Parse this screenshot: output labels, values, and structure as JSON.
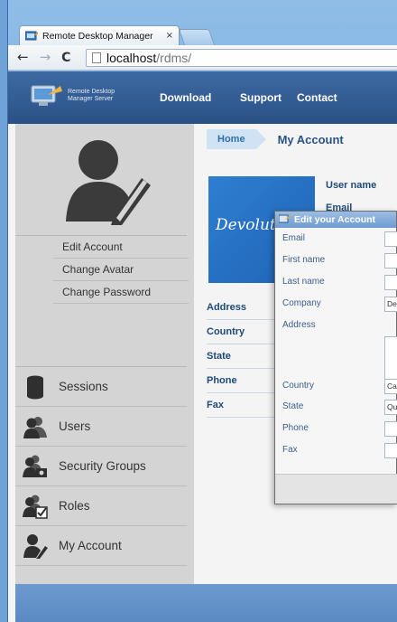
{
  "browser": {
    "tab_title": "Remote Desktop Manager",
    "tab_close": "×",
    "url_host": "localhost",
    "url_path": "/rdms/",
    "back_glyph": "←",
    "forward_glyph": "→",
    "reload_glyph": "C"
  },
  "header": {
    "logo_line1": "Remote Desktop",
    "logo_line2": "Manager Server",
    "menu": [
      "Download",
      "Support",
      "Contact"
    ]
  },
  "sidebar": {
    "account_links": [
      "Edit Account",
      "Change Avatar",
      "Change Password"
    ],
    "nav_items": [
      {
        "label": "Sessions",
        "icon": "database-icon"
      },
      {
        "label": "Users",
        "icon": "users-icon"
      },
      {
        "label": "Security Groups",
        "icon": "security-groups-icon"
      },
      {
        "label": "Roles",
        "icon": "roles-icon"
      },
      {
        "label": "My Account",
        "icon": "user-edit-icon"
      }
    ]
  },
  "content": {
    "breadcrumb_home": "Home",
    "page_title": "My Account",
    "company_logo_text": "Devolutions",
    "user_name_label": "User name",
    "email_label": "Email",
    "field_labels": [
      "Address",
      "Country",
      "State",
      "Phone",
      "Fax"
    ]
  },
  "dialog": {
    "title": "Edit your Account",
    "fields": [
      {
        "label": "Email",
        "value": ""
      },
      {
        "label": "First name",
        "value": ""
      },
      {
        "label": "Last name",
        "value": ""
      },
      {
        "label": "Company",
        "value": "Devolutions"
      },
      {
        "label": "Address",
        "value": ""
      },
      {
        "label": "Country",
        "value": "Canada"
      },
      {
        "label": "State",
        "value": "Quebec"
      },
      {
        "label": "Phone",
        "value": ""
      },
      {
        "label": "Fax",
        "value": ""
      }
    ]
  },
  "colors": {
    "header_blue": "#2b5184",
    "sidebar_gray": "#d4d4d4",
    "breadcrumb_bg": "#cfe3f4",
    "title_blue": "#2a5384"
  }
}
